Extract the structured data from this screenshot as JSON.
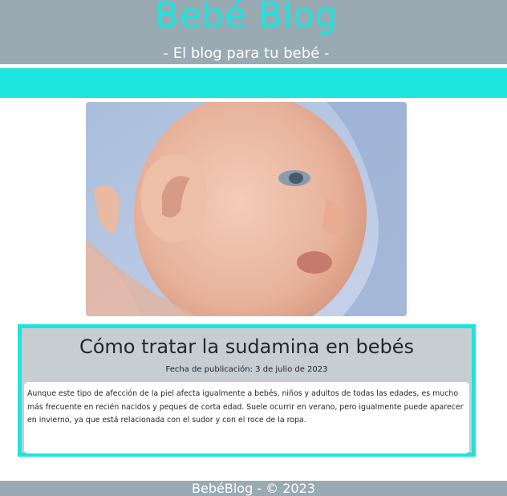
{
  "header": {
    "title": "Bebé Blog",
    "subtitle": "- El blog para tu bebé -"
  },
  "hero": {
    "image": "baby-photo"
  },
  "post": {
    "title": "Cómo tratar la sudamina en bebés",
    "date": "Fecha de publicación: 3 de julio de 2023",
    "body": "Aunque este tipo de afección de la piel afecta igualmente a bebés, niños y adultos de todas las edades, es mucho más frecuente en recién nacidos y peques de corta edad. Suele ocurrir en verano, pero igualmente puede aparecer en invierno, ya que está relacionada con el sudor y con el roce de la ropa."
  },
  "footer": {
    "text": "BebéBlog - © 2023"
  },
  "colors": {
    "accent": "#1de4dd",
    "header_bg": "#9aaab3",
    "card_bg": "#c6ced2"
  }
}
